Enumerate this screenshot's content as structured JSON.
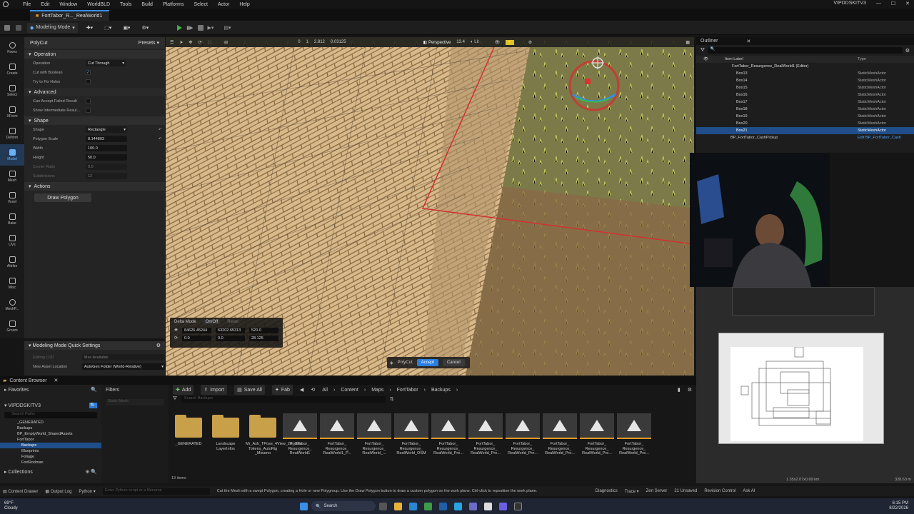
{
  "menu": {
    "items": [
      "File",
      "Edit",
      "Window",
      "WorldBLD",
      "Tools",
      "Build",
      "Platforms",
      "Select",
      "Actor",
      "Help"
    ],
    "project": "VIPDDSKITV3"
  },
  "doc_tab": "FortTabor_R..._RealWorld1",
  "toolbar": {
    "mode": "Modeling Mode"
  },
  "modes": [
    "Faves",
    "Create",
    "Select",
    "XForm",
    "Deform",
    "Model",
    "Mesh",
    "Voxel",
    "Bake",
    "UVs",
    "Attribs",
    "Misc",
    "MeshP...",
    "Groom"
  ],
  "details": {
    "title": "PolyCut",
    "presets": "Presets",
    "operation": {
      "header": "Operation",
      "operation_label": "Operation",
      "operation_value": "Cut Through",
      "boolean_label": "Cut with Boolean",
      "fix_label": "Try to Fix Holes"
    },
    "advanced": {
      "header": "Advanced",
      "failed_label": "Can Accept Failed Result",
      "intermediate_label": "Show Intermediate Resul..."
    },
    "shape": {
      "header": "Shape",
      "shape_label": "Shape",
      "shape_value": "Rectangle",
      "scale_label": "Polygon Scale",
      "scale_value": "8.144803",
      "width_label": "Width",
      "width_value": "100.0",
      "height_label": "Height",
      "height_value": "50.0",
      "corner_label": "Corner Ratio",
      "corner_value": "0.5",
      "sub_label": "Subdivisions",
      "sub_value": "12"
    },
    "actions": {
      "header": "Actions",
      "draw": "Draw Polygon"
    }
  },
  "quick": {
    "header": "Modeling Mode Quick Settings",
    "lod_label": "Editing LOD",
    "lod_value": "Max Available",
    "loc_label": "New Asset Location",
    "loc_value": "AutoGen Folder (World-Relative)"
  },
  "viewport": {
    "perspective": "Perspective",
    "lit": "Lit",
    "fov": "13.4",
    "snap1": "0",
    "snap2": "1",
    "snap3": "2.812",
    "snap4": "0.03125",
    "delta": {
      "title": "Delta Mode",
      "onoff": "On/Off",
      "reset": "Reset",
      "x": "84626.45244",
      "y": "63202.65313",
      "z": "520.0",
      "r1": "0.0",
      "r2": "0.0",
      "r3": "28.125"
    },
    "polycut": "PolyCut",
    "accept": "Accept",
    "cancel": "Cancel"
  },
  "outliner": {
    "title": "Outliner",
    "col_label": "Item Label",
    "col_type": "Type",
    "root": "FortTabor_Resurgence_RealWorld1 (Editor)",
    "rows": [
      {
        "name": "Box13",
        "type": "StaticMeshActor"
      },
      {
        "name": "Box14",
        "type": "StaticMeshActor"
      },
      {
        "name": "Box15",
        "type": "StaticMeshActor"
      },
      {
        "name": "Box16",
        "type": "StaticMeshActor"
      },
      {
        "name": "Box17",
        "type": "StaticMeshActor"
      },
      {
        "name": "Box18",
        "type": "StaticMeshActor"
      },
      {
        "name": "Box19",
        "type": "StaticMeshActor"
      },
      {
        "name": "Box20",
        "type": "StaticMeshActor"
      },
      {
        "name": "Box21",
        "type": "StaticMeshActor"
      },
      {
        "name": "BP_FortTabor_CashPickup",
        "type": "Edit BP_FortTabor_Cash"
      }
    ]
  },
  "minimap": {
    "dims": "1.35x2.07x0.69 km",
    "scale": "328.63 m"
  },
  "content": {
    "tab": "Content Browser",
    "favorites": "Favorites",
    "filters": "Filters",
    "static_mesh": "Static Mesh",
    "project": "VIPDDSKITV3",
    "search_paths": "Search Paths",
    "tree": [
      "_GENERATED",
      "Backups",
      "BP_EmptyWorld_SharedAssets",
      "FortTabor",
      "Backups",
      "Blueprints",
      "Foliage",
      "FortRodman"
    ],
    "add": "Add",
    "import": "Import",
    "save_all": "Save All",
    "fab": "Fab",
    "path": [
      "All",
      "Content",
      "Maps",
      "FortTabor",
      "Backups"
    ],
    "search_backups": "Search Backups",
    "collections": "Collections",
    "count": "13 items",
    "assets": [
      {
        "name": "_GENERATED",
        "kind": "folder"
      },
      {
        "name": "Landscape LayerInfos",
        "kind": "folder"
      },
      {
        "name": "Mr_Ash_TPose_4View_2K_Skin Tokens_AutoRig _Mixamo",
        "kind": "folder"
      },
      {
        "name": "FortTabor_ Resurgence_ RealWorld1",
        "kind": "level"
      },
      {
        "name": "FortTabor_ Resurgence_ RealWorld1_P...",
        "kind": "level"
      },
      {
        "name": "FortTabor_ Resurgence_ RealWorld_...",
        "kind": "level"
      },
      {
        "name": "FortTabor_ Resurgence_ RealWorld_OSM",
        "kind": "level"
      },
      {
        "name": "FortTabor_ Resurgence_ RealWorld_Pre...",
        "kind": "level"
      },
      {
        "name": "FortTabor_ Resurgence_ RealWorld_Pre...",
        "kind": "level"
      },
      {
        "name": "FortTabor_ Resurgence_ RealWorld_Pre...",
        "kind": "level"
      },
      {
        "name": "FortTabor_ Resurgence_ RealWorld_Pre...",
        "kind": "level"
      },
      {
        "name": "FortTabor_ Resurgence_ RealWorld_Pre...",
        "kind": "level"
      },
      {
        "name": "FortTabor_ Resurgence_ RealWorld_Pre...",
        "kind": "level"
      }
    ]
  },
  "status": {
    "drawer": "Content Drawer",
    "output": "Output Log",
    "python": "Python",
    "cmd_placeholder": "Enter Python script or a filename",
    "hint": "Cut the Mesh with a swept Polygon, creating a Hole or new Polygroup. Use the Draw Polygon button to draw a custom polygon on the work plane. Ctrl-click to reposition the work plane.",
    "diagnostics": "Diagnostics",
    "trace": "Trace",
    "zen": "Zen Server",
    "unsaved": "21 Unsaved",
    "revision": "Revision Control",
    "ask": "Ask AI"
  },
  "taskbar": {
    "temp": "69°F",
    "weather": "Cloudy",
    "search": "Search",
    "time": "6:15 PM",
    "date": "8/22/2026"
  }
}
